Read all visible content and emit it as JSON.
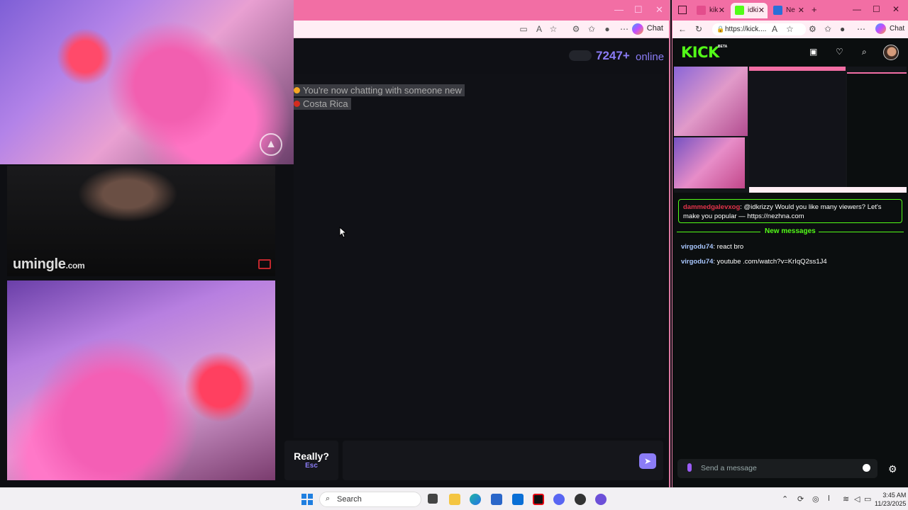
{
  "left_browser": {
    "chat_button_label": "Chat"
  },
  "umingle": {
    "online_count": "7247+",
    "online_label": "online",
    "logo_main": "umingle",
    "logo_suffix": ".com",
    "messages": [
      {
        "text": "You're now chatting with someone new",
        "flag_color": "#f5a623"
      },
      {
        "text": "Costa Rica",
        "flag_color": "#d52b1e"
      }
    ],
    "really_label": "Really?",
    "really_key": "Esc"
  },
  "right_browser": {
    "tabs": [
      {
        "label": "kik",
        "fav_color": "#e34d8c"
      },
      {
        "label": "idki",
        "fav_color": "#53fc18"
      },
      {
        "label": "Ne",
        "fav_color": "#2a6fd8"
      }
    ],
    "url": "https://kick....",
    "chat_button_label": "Chat"
  },
  "kick": {
    "logo": "KICK",
    "beta": "BETA",
    "pinned": {
      "user": "dammedgalevxog",
      "text": ": @idkrizzy Would you like many viewers? Let's make you popular — https://nezhna.com"
    },
    "new_messages_label": "New messages",
    "messages": [
      {
        "user": "virgodu74",
        "text": ": react bro"
      },
      {
        "user": "virgodu74",
        "text": ": youtube .com/watch?v=KrIqQ2ss1J4"
      }
    ],
    "input_placeholder": "Send a message",
    "accent": "#53fc18"
  },
  "taskbar": {
    "search_label": "Search",
    "time": "3:45 AM",
    "date": "11/23/2025"
  }
}
